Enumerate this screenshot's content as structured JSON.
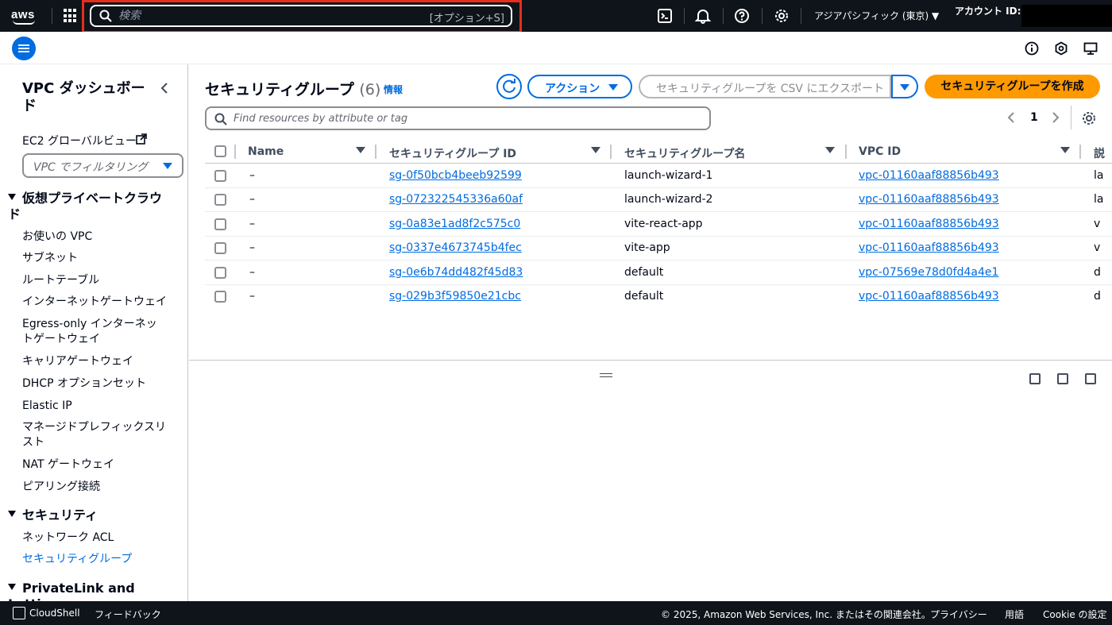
{
  "topnav": {
    "logo_text": "aws",
    "search_placeholder": "検索",
    "search_shortcut": "[オプション+S]",
    "region": "アジアパシフィック (東京) ▼",
    "account_label": "アカウント ID:"
  },
  "sidebar": {
    "title": "VPC ダッシュボード",
    "global_view": "EC2 グローバルビュー",
    "filter_placeholder": "VPC でフィルタリング",
    "sections": [
      {
        "title": "仮想プライベートクラウド",
        "items": [
          "お使いの VPC",
          "サブネット",
          "ルートテーブル",
          "インターネットゲートウェイ",
          "Egress-only インターネットゲートウェイ",
          "キャリアゲートウェイ",
          "DHCP オプションセット",
          "Elastic IP",
          "マネージドプレフィックスリスト",
          "NAT ゲートウェイ",
          "ピアリング接続"
        ]
      },
      {
        "title": "セキュリティ",
        "items": [
          "ネットワーク ACL",
          "セキュリティグループ"
        ]
      },
      {
        "title": "PrivateLink and Lattice",
        "items": []
      }
    ],
    "active_item": "セキュリティグループ"
  },
  "main": {
    "title": "セキュリティグループ",
    "count": "(6)",
    "info": "情報",
    "actions_label": "アクション",
    "export_label": "セキュリティグループを CSV にエクスポート",
    "create_label": "セキュリティグループを作成",
    "filter_placeholder": "Find resources by attribute or tag",
    "page": "1",
    "columns": [
      "Name",
      "セキュリティグループ ID",
      "セキュリティグループ名",
      "VPC ID",
      "説"
    ],
    "rows": [
      {
        "name": "–",
        "sg_id": "sg-0f50bcb4beeb92599",
        "sg_name": "launch-wizard-1",
        "vpc_id": "vpc-01160aaf88856b493",
        "desc": "la"
      },
      {
        "name": "–",
        "sg_id": "sg-072322545336a60af",
        "sg_name": "launch-wizard-2",
        "vpc_id": "vpc-01160aaf88856b493",
        "desc": "la"
      },
      {
        "name": "–",
        "sg_id": "sg-0a83e1ad8f2c575c0",
        "sg_name": "vite-react-app",
        "vpc_id": "vpc-01160aaf88856b493",
        "desc": "v"
      },
      {
        "name": "–",
        "sg_id": "sg-0337e4673745b4fec",
        "sg_name": "vite-app",
        "vpc_id": "vpc-01160aaf88856b493",
        "desc": "v"
      },
      {
        "name": "–",
        "sg_id": "sg-0e6b74dd482f45d83",
        "sg_name": "default",
        "vpc_id": "vpc-07569e78d0fd4a4e1",
        "desc": "d"
      },
      {
        "name": "–",
        "sg_id": "sg-029b3f59850e21cbc",
        "sg_name": "default",
        "vpc_id": "vpc-01160aaf88856b493",
        "desc": "d"
      }
    ]
  },
  "footer": {
    "cloudshell": "CloudShell",
    "feedback": "フィードバック",
    "copyright": "© 2025, Amazon Web Services, Inc. またはその関連会社。",
    "privacy": "プライバシー",
    "terms": "用語",
    "cookie": "Cookie の設定"
  },
  "colors": {
    "nav_bg": "#0f141a",
    "link": "#006ce0",
    "primary_button": "#ff9900",
    "highlight": "#e52e1e"
  }
}
